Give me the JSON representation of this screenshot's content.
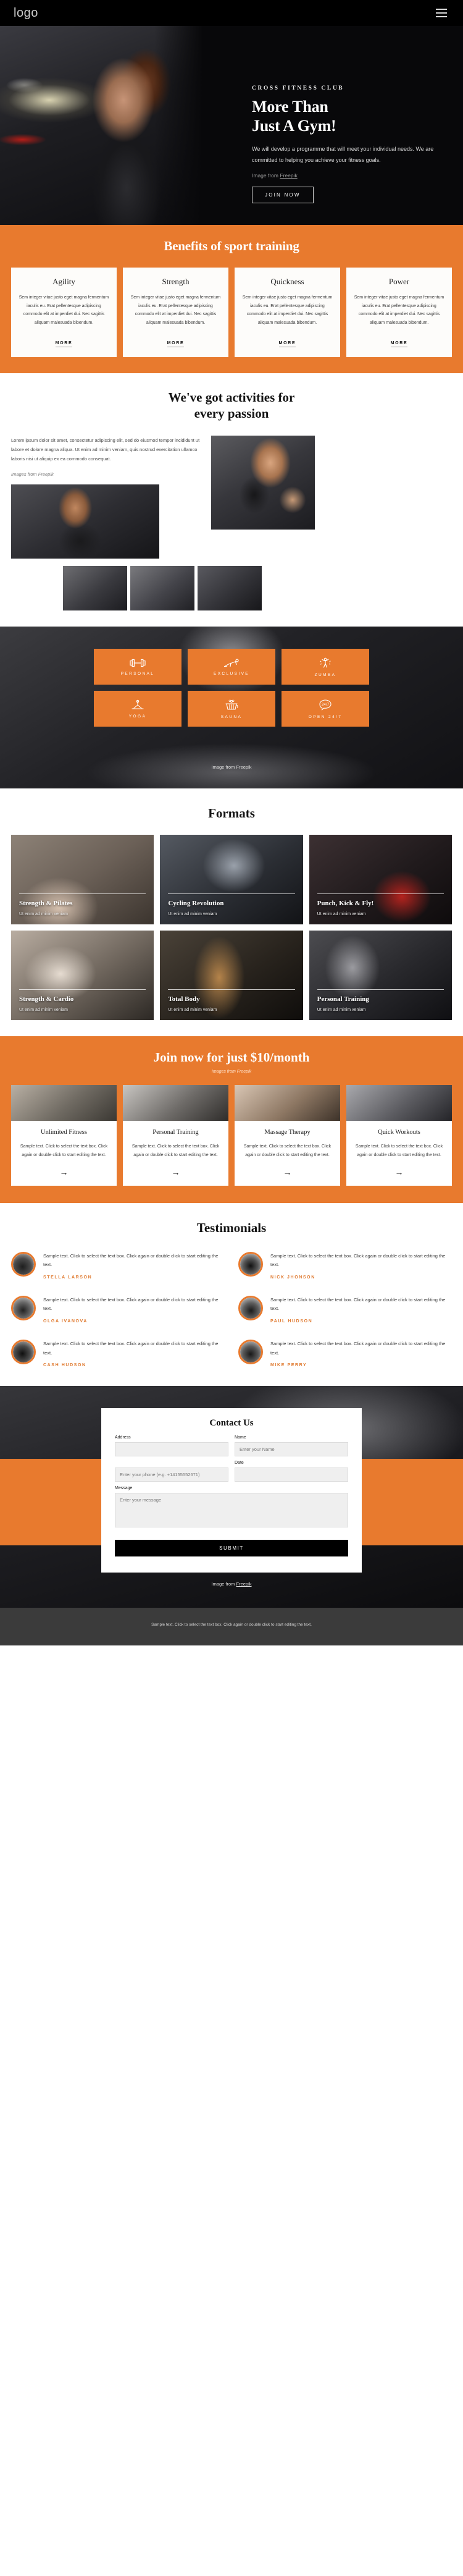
{
  "theme": {
    "accent": "#e87a2e",
    "dark": "#000000",
    "footer_bg": "#3b3b3b"
  },
  "topbar": {
    "logo": "logo",
    "menu_icon": "hamburger-menu-icon"
  },
  "hero": {
    "kicker": "CROSS FITNESS CLUB",
    "title_line1": "More Than",
    "title_line2": "Just A Gym!",
    "paragraph": "We will develop a programme that will meet your individual needs. We are committed to helping you achieve your fitness goals.",
    "credit_prefix": "Image from ",
    "credit_link": "Freepik",
    "cta": "JOIN NOW"
  },
  "benefits": {
    "heading": "Benefits of sport training",
    "more_label": "MORE",
    "body": "Sem integer vitae justo eget magna fermentum iaculis eu. Erat pellentesque adipiscing commodo elit at imperdiet dui. Nec sagittis aliquam malesuada bibendum.",
    "cards": [
      {
        "title": "Agility"
      },
      {
        "title": "Strength"
      },
      {
        "title": "Quickness"
      },
      {
        "title": "Power"
      }
    ]
  },
  "activities": {
    "heading_line1": "We've got activities for",
    "heading_line2": "every passion",
    "paragraph": "Lorem ipsum dolor sit amet, consectetur adipiscing elit, sed do eiusmod tempor incididunt ut labore et dolore magna aliqua. Ut enim ad minim veniam, quis nostrud exercitation ullamco laboris nisi ut aliquip ex ea commodo consequat.",
    "credit": "Images from Freepik"
  },
  "services": {
    "credit": "Image from Freepik",
    "items": [
      {
        "label": "PERSONAL",
        "icon": "dumbbell-icon"
      },
      {
        "label": "EXCLUSIVE",
        "icon": "plank-exercise-icon"
      },
      {
        "label": "ZUMBA",
        "icon": "dancer-icon"
      },
      {
        "label": "YOGA",
        "icon": "yoga-pose-icon"
      },
      {
        "label": "SAUNA",
        "icon": "sauna-bucket-icon"
      },
      {
        "label": "OPEN 24/7",
        "icon": "24-7-badge-icon"
      }
    ]
  },
  "formats": {
    "heading": "Formats",
    "subtitle": "Ut enim ad minim veniam",
    "cards": [
      {
        "title": "Strength & Pilates"
      },
      {
        "title": "Cycling Revolution"
      },
      {
        "title": "Punch, Kick & Fly!"
      },
      {
        "title": "Strength & Cardio"
      },
      {
        "title": "Total Body"
      },
      {
        "title": "Personal Training"
      }
    ]
  },
  "pricing": {
    "heading": "Join now for just $10/month",
    "credit": "Images from Freepik",
    "body": "Sample text. Click to select the text box. Click again or double click to start editing the text.",
    "arrow": "→",
    "cards": [
      {
        "title": "Unlimited Fitness"
      },
      {
        "title": "Personal Training"
      },
      {
        "title": "Massage Therapy"
      },
      {
        "title": "Quick Workouts"
      }
    ]
  },
  "testimonials": {
    "heading": "Testimonials",
    "body": "Sample text. Click to select the text box. Click again or double click to start editing the text.",
    "items": [
      {
        "name": "STELLA LARSON"
      },
      {
        "name": "NICK JHONSON"
      },
      {
        "name": "OLGA IVANOVA"
      },
      {
        "name": "PAUL HUDSON"
      },
      {
        "name": "CASH HUDSON"
      },
      {
        "name": "MIKE PERRY"
      }
    ]
  },
  "contact": {
    "heading": "Contact Us",
    "address_label": "Address",
    "address_value": "",
    "name_label": "Name",
    "name_placeholder": "Enter your Name",
    "phone_placeholder": "Enter your phone (e.g. +14155552671)",
    "date_label": "Date",
    "date_value": "",
    "message_label": "Message",
    "message_placeholder": "Enter your message",
    "submit_label": "SUBMIT",
    "credit_prefix": "Image from ",
    "credit_link": "Freepik"
  },
  "footer": {
    "text": "Sample text. Click to select the text box. Click again or double click to start editing the text."
  }
}
